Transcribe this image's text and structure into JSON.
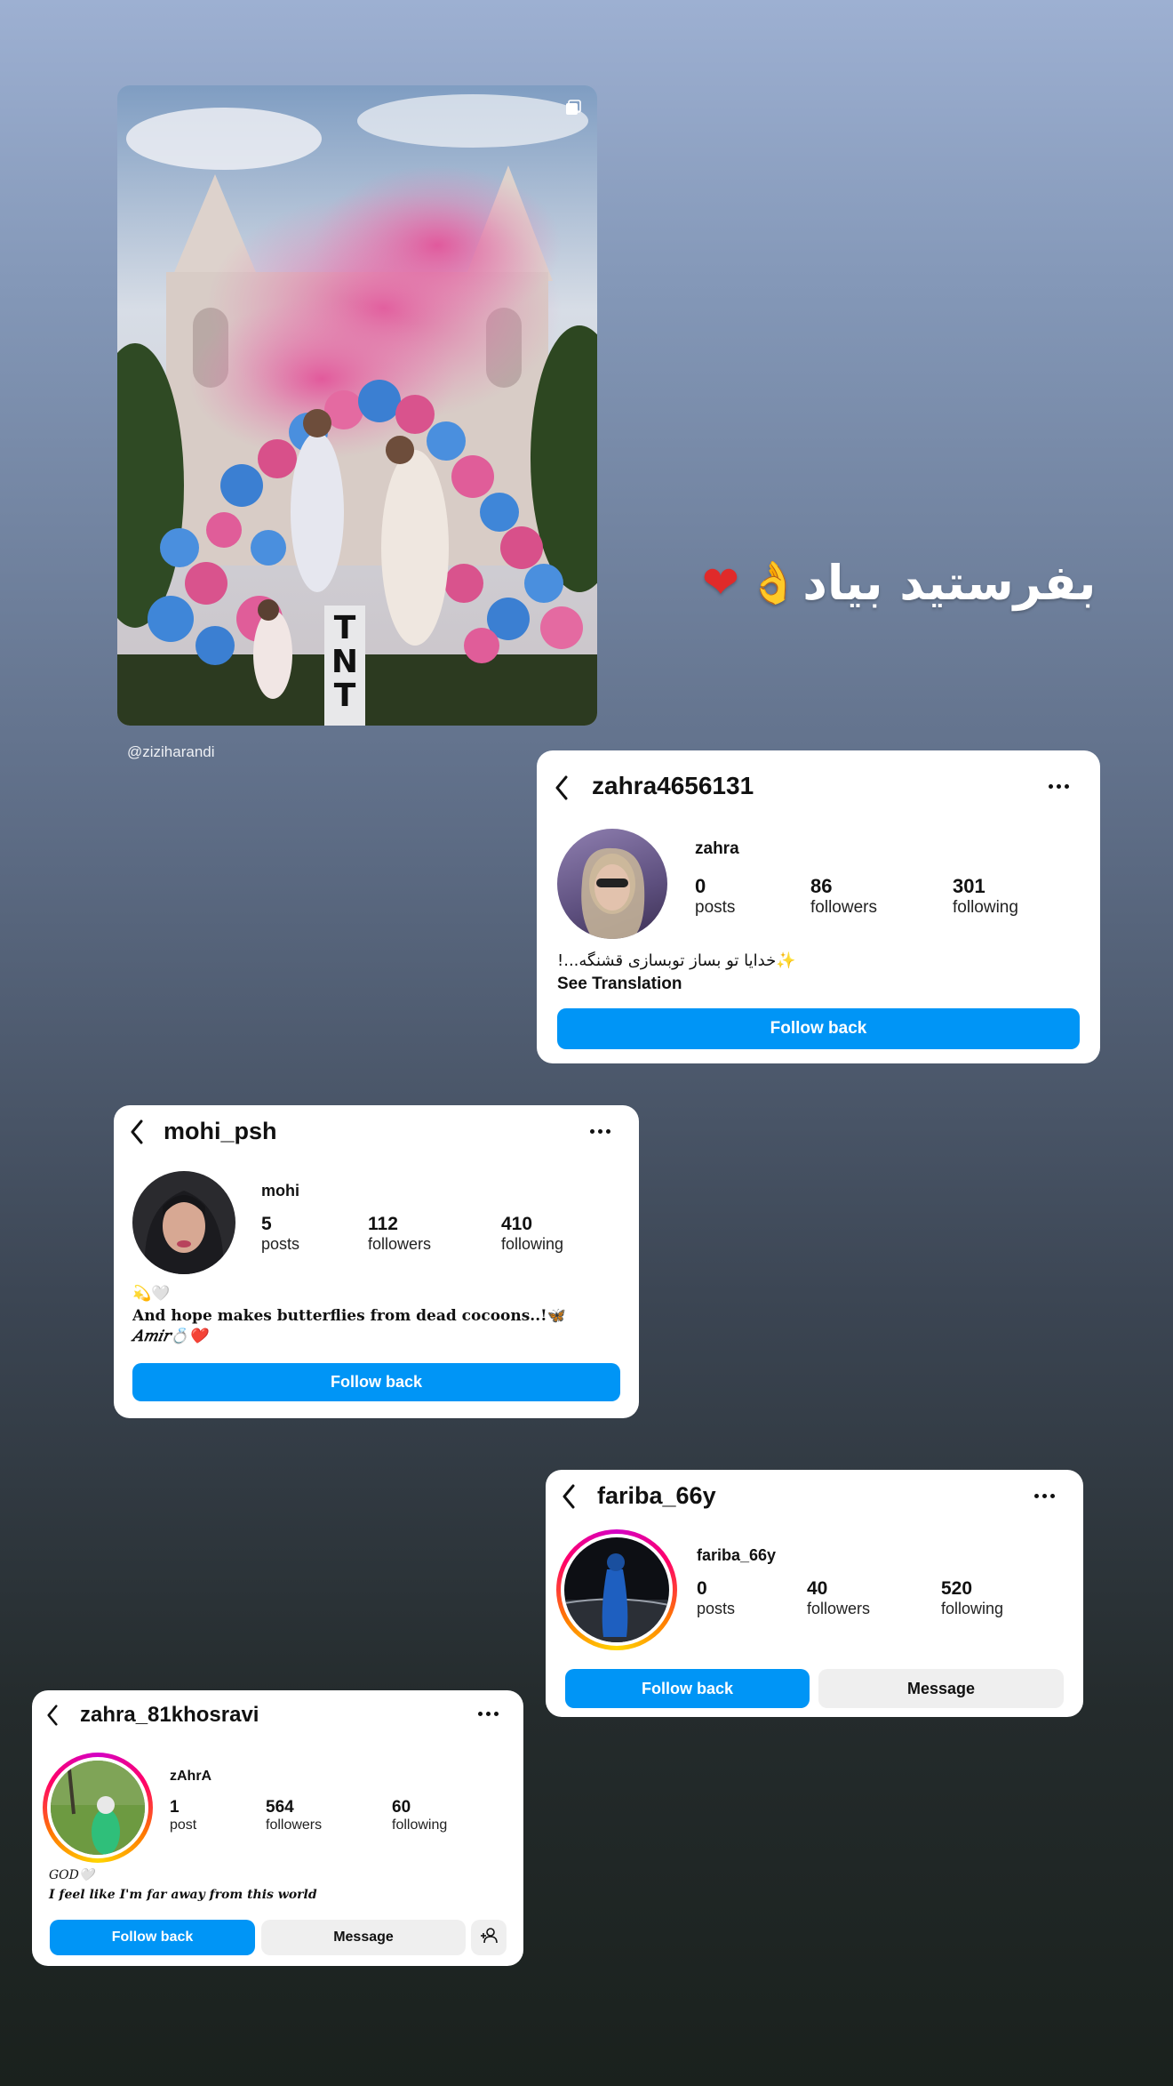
{
  "post": {
    "credit": "@ziziharandi",
    "sign_text": "TNT"
  },
  "story_text": "بفرستید بیاد",
  "cards": {
    "zahra4656131": {
      "username": "zahra4656131",
      "display_name": "zahra",
      "posts": "0",
      "posts_label": "posts",
      "followers": "86",
      "followers_label": "followers",
      "following": "301",
      "following_label": "following",
      "bio": "✨خدایا تو بساز توبسازی قشنگه...!",
      "see_translation": "See Translation",
      "follow_back": "Follow back"
    },
    "mohi_psh": {
      "username": "mohi_psh",
      "display_name": "mohi",
      "posts": "5",
      "posts_label": "posts",
      "followers": "112",
      "followers_label": "followers",
      "following": "410",
      "following_label": "following",
      "bio_line1": "💫🤍",
      "bio_line2": "And hope makes butterflies from dead cocoons..!🦋",
      "bio_line3": "𝐴𝑚𝑖𝑟💍❤️",
      "follow_back": "Follow back"
    },
    "fariba_66y": {
      "username": "fariba_66y",
      "display_name": "fariba_66y",
      "posts": "0",
      "posts_label": "posts",
      "followers": "40",
      "followers_label": "followers",
      "following": "520",
      "following_label": "following",
      "follow_back": "Follow back",
      "message": "Message"
    },
    "zahra_81khosravi": {
      "username": "zahra_81khosravi",
      "display_name": "zAhrA",
      "posts": "1",
      "posts_label": "post",
      "followers": "564",
      "followers_label": "followers",
      "following": "60",
      "following_label": "following",
      "bio_line1": "GOD🤍",
      "bio_line2": "I feel like I'm far away from this world",
      "follow_back": "Follow back",
      "message": "Message"
    }
  },
  "icons": {
    "back": "chevron-left-icon",
    "more": "more-dots-icon",
    "multi": "carousel-icon",
    "add_person": "add-person-icon"
  }
}
